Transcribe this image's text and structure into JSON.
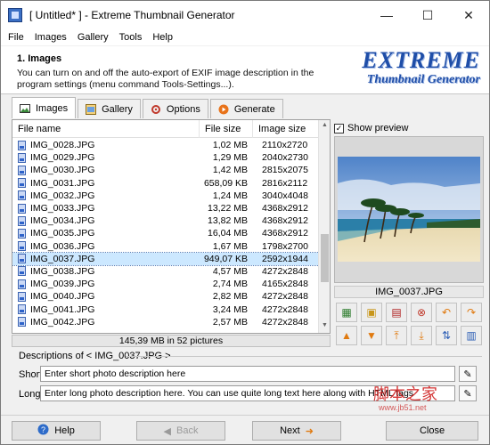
{
  "window": {
    "title": "[ Untitled* ] - Extreme Thumbnail Generator",
    "minimize": "—",
    "maximize": "☐",
    "close": "✕"
  },
  "menu": {
    "file": "File",
    "images": "Images",
    "gallery": "Gallery",
    "tools": "Tools",
    "help": "Help"
  },
  "header": {
    "title": "1. Images",
    "description": "You can turn on and off the auto-export of EXIF image description in the program settings (menu command Tools-Settings...).",
    "logo_line1": "EXTREME",
    "logo_line2": "Thumbnail Generator"
  },
  "tabs": [
    {
      "label": "Images",
      "icon": "images-icon",
      "active": true
    },
    {
      "label": "Gallery",
      "icon": "gallery-icon",
      "active": false
    },
    {
      "label": "Options",
      "icon": "options-icon",
      "active": false
    },
    {
      "label": "Generate",
      "icon": "generate-icon",
      "active": false
    }
  ],
  "filelist": {
    "columns": {
      "name": "File name",
      "size": "File size",
      "image_size": "Image size"
    },
    "rows": [
      {
        "name": "IMG_0028.JPG",
        "size": "1,02 MB",
        "dims": "2110x2720"
      },
      {
        "name": "IMG_0029.JPG",
        "size": "1,29 MB",
        "dims": "2040x2730"
      },
      {
        "name": "IMG_0030.JPG",
        "size": "1,42 MB",
        "dims": "2815x2075"
      },
      {
        "name": "IMG_0031.JPG",
        "size": "658,09 KB",
        "dims": "2816x2112"
      },
      {
        "name": "IMG_0032.JPG",
        "size": "1,24 MB",
        "dims": "3040x4048"
      },
      {
        "name": "IMG_0033.JPG",
        "size": "13,22 MB",
        "dims": "4368x2912"
      },
      {
        "name": "IMG_0034.JPG",
        "size": "13,82 MB",
        "dims": "4368x2912"
      },
      {
        "name": "IMG_0035.JPG",
        "size": "16,04 MB",
        "dims": "4368x2912"
      },
      {
        "name": "IMG_0036.JPG",
        "size": "1,67 MB",
        "dims": "1798x2700"
      },
      {
        "name": "IMG_0037.JPG",
        "size": "949,07 KB",
        "dims": "2592x1944",
        "selected": true
      },
      {
        "name": "IMG_0038.JPG",
        "size": "4,57 MB",
        "dims": "4272x2848"
      },
      {
        "name": "IMG_0039.JPG",
        "size": "2,74 MB",
        "dims": "4165x2848"
      },
      {
        "name": "IMG_0040.JPG",
        "size": "2,82 MB",
        "dims": "4272x2848"
      },
      {
        "name": "IMG_0041.JPG",
        "size": "3,24 MB",
        "dims": "4272x2848"
      },
      {
        "name": "IMG_0042.JPG",
        "size": "2,57 MB",
        "dims": "4272x2848"
      }
    ],
    "summary": "145,39 MB in 52 pictures"
  },
  "preview": {
    "checkbox_label": "Show preview",
    "checked": true,
    "filename": "IMG_0037.JPG"
  },
  "toolbar": {
    "icons": [
      "add-images-icon",
      "add-folder-icon",
      "remove-image-icon",
      "remove-all-icon",
      "undo-icon",
      "redo-icon",
      "move-up-icon",
      "move-down-icon",
      "move-top-icon",
      "move-bottom-icon",
      "sort-icon",
      "properties-icon"
    ]
  },
  "descriptions": {
    "label": "Descriptions of < IMG_0037.JPG >",
    "short_label": "Short",
    "short_value": "Enter short photo description here",
    "long_label": "Long",
    "long_value": "Enter long photo description here. You can use quite long text here along with HTML tags"
  },
  "footer": {
    "help": "Help",
    "back": "Back",
    "next": "Next",
    "close": "Close"
  },
  "watermark": {
    "line1": "脚本之家",
    "line2": "www.jb51.net"
  },
  "colors": {
    "selection": "#cce8ff",
    "logo_blue": "#1f4ea8"
  }
}
